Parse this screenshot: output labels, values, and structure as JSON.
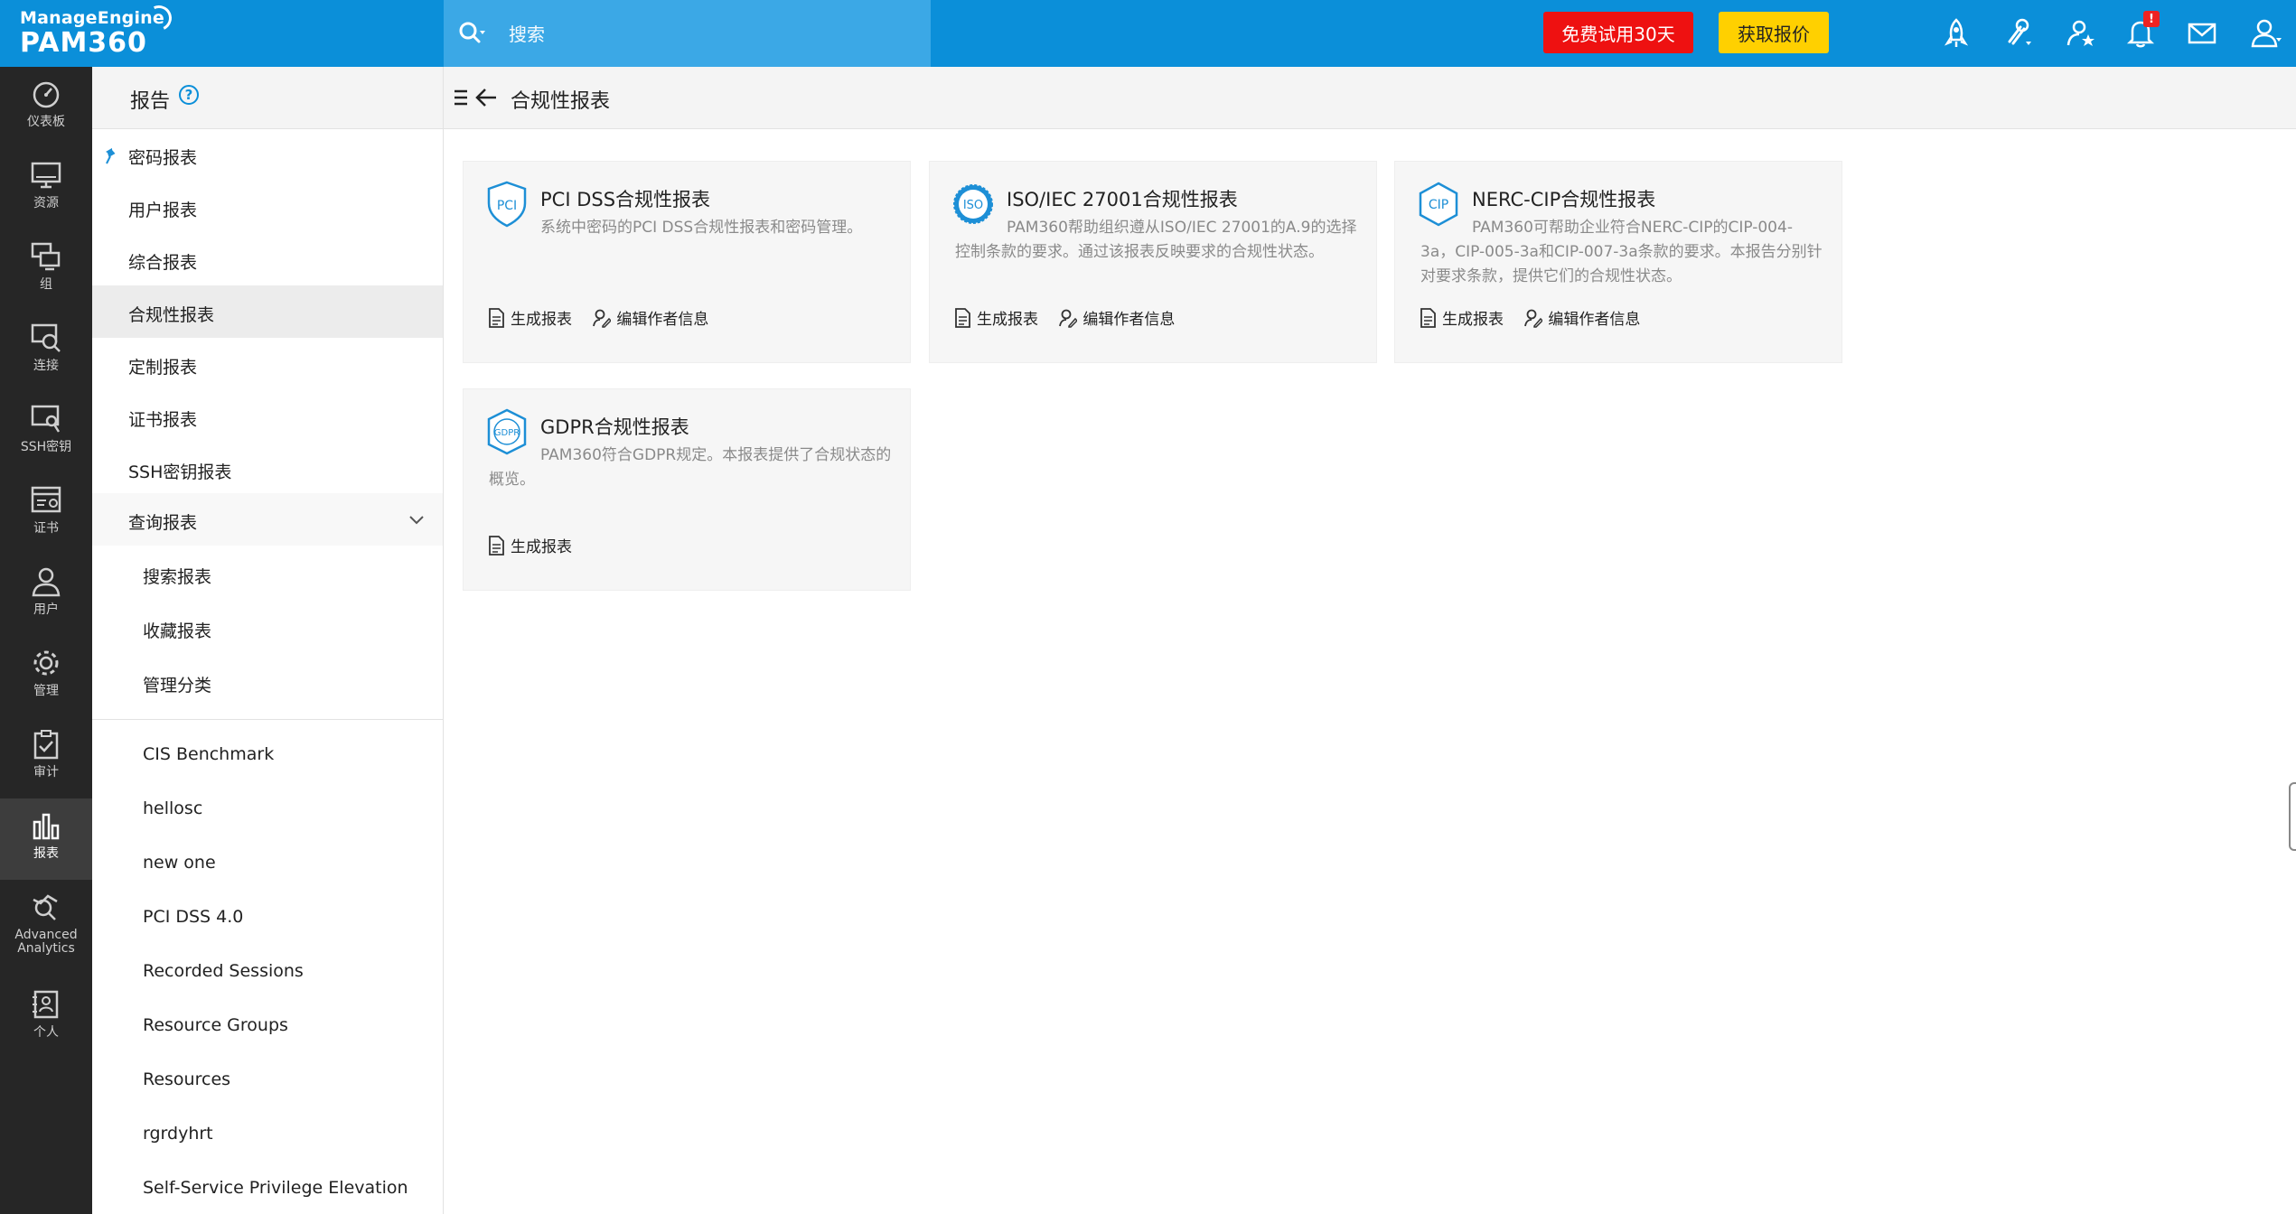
{
  "brand": {
    "company": "ManageEngine",
    "product": "PAM360"
  },
  "search": {
    "placeholder": "搜索"
  },
  "topbar": {
    "trial_label": "免费试用30天",
    "quote_label": "获取报价",
    "notification_count": "!"
  },
  "leftnav": [
    {
      "label": "仪表板",
      "icon": "dashboard-icon"
    },
    {
      "label": "资源",
      "icon": "monitor-icon"
    },
    {
      "label": "组",
      "icon": "group-icon"
    },
    {
      "label": "连接",
      "icon": "connection-icon"
    },
    {
      "label": "SSH密钥",
      "icon": "ssh-key-icon"
    },
    {
      "label": "证书",
      "icon": "certificate-icon"
    },
    {
      "label": "用户",
      "icon": "user-icon"
    },
    {
      "label": "管理",
      "icon": "gear-icon"
    },
    {
      "label": "审计",
      "icon": "audit-icon"
    },
    {
      "label": "报表",
      "icon": "bar-chart-icon"
    },
    {
      "label": "Advanced Analytics",
      "icon": "analytics-icon"
    },
    {
      "label": "个人",
      "icon": "personal-icon"
    }
  ],
  "sidepanel": {
    "title": "报告",
    "items": [
      "密码报表",
      "用户报表",
      "综合报表",
      "合规性报表",
      "定制报表",
      "证书报表",
      "SSH密钥报表",
      "查询报表"
    ],
    "query_subitems": [
      "搜索报表",
      "收藏报表",
      "管理分类"
    ],
    "saved_reports": [
      "CIS Benchmark",
      "hellosc",
      "new one",
      "PCI DSS 4.0",
      "Recorded Sessions",
      "Resource Groups",
      "Resources",
      "rgrdyhrt",
      "Self-Service Privilege Elevation"
    ]
  },
  "main": {
    "title": "合规性报表",
    "cards": [
      {
        "logo": "PCI",
        "title": "PCI DSS合规性报表",
        "desc": "系统中密码的PCI DSS合规性报表和密码管理。",
        "generate": "生成报表",
        "edit": "编辑作者信息"
      },
      {
        "logo": "ISO",
        "title": "ISO/IEC 27001合规性报表",
        "desc": "PAM360帮助组织遵从ISO/IEC 27001的A.9的选择控制条款的要求。通过该报表反映要求的合规性状态。",
        "generate": "生成报表",
        "edit": "编辑作者信息"
      },
      {
        "logo": "CIP",
        "title": "NERC-CIP合规性报表",
        "desc": "PAM360可帮助企业符合NERC-CIP的CIP-004-3a，CIP-005-3a和CIP-007-3a条款的要求。本报告分别针对要求条款，提供它们的合规性状态。",
        "generate": "生成报表",
        "edit": "编辑作者信息"
      },
      {
        "logo": "GDPR",
        "title": "GDPR合规性报表",
        "desc": "PAM360符合GDPR规定。本报表提供了合规状态的概览。",
        "generate": "生成报表"
      }
    ]
  },
  "colors": {
    "topbar": "#0b8fd9",
    "search_bg": "#3ba8e6",
    "trial_button": "#ee1111",
    "quote_button": "#ffd000",
    "leftnav": "#262626",
    "accent": "#1d8fd6"
  }
}
